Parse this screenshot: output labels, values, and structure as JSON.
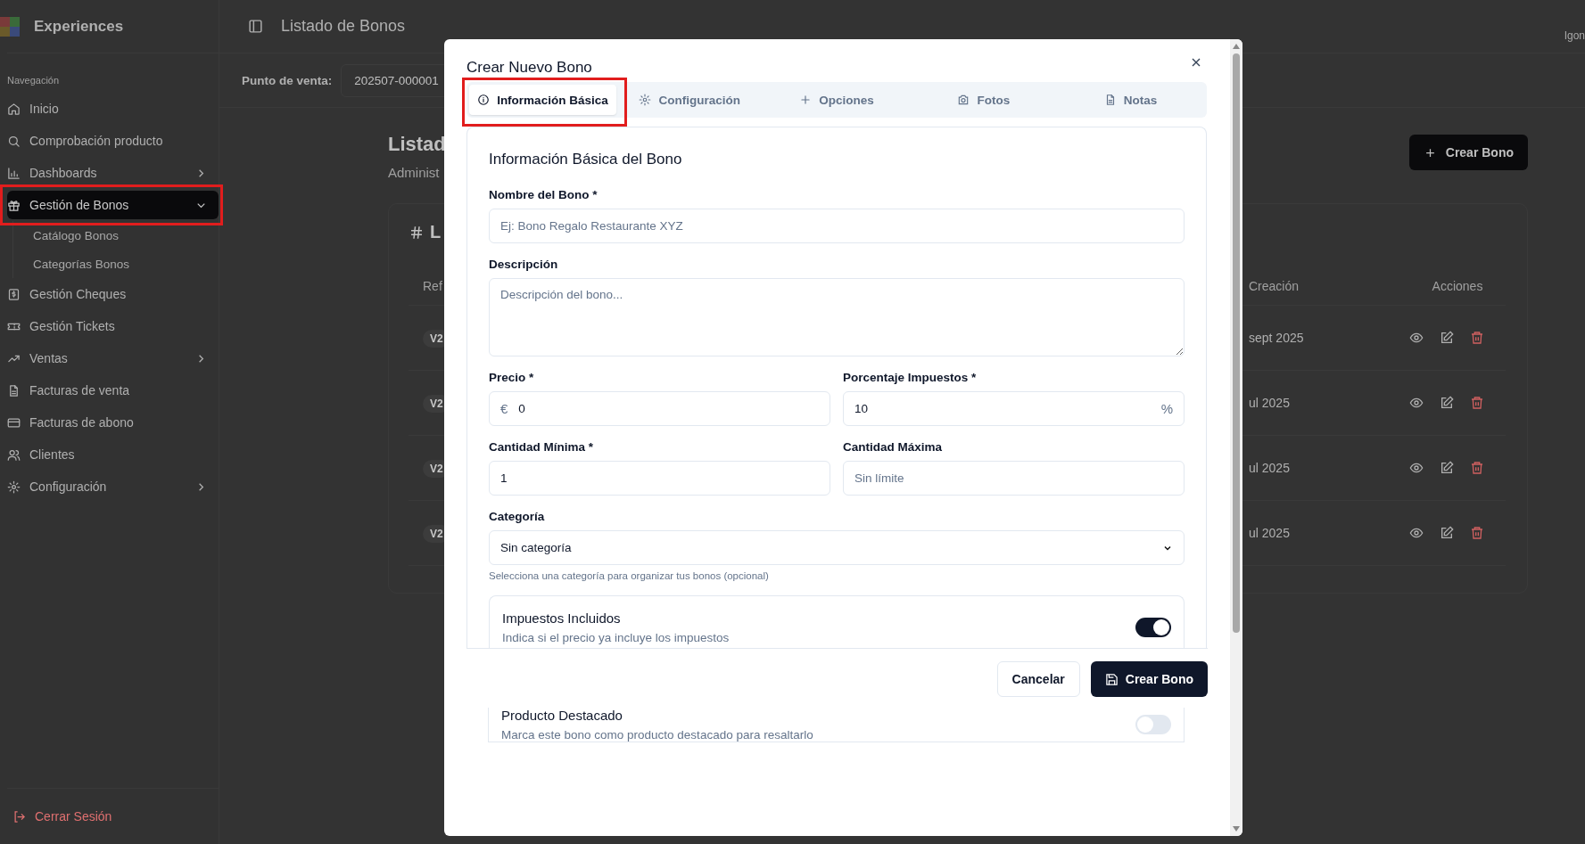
{
  "sidebar": {
    "brand": "Experiences",
    "section_label": "Navegación",
    "items": [
      {
        "label": "Inicio",
        "selected": false,
        "highlighted": false
      },
      {
        "label": "Comprobación producto",
        "selected": false,
        "highlighted": false
      },
      {
        "label": "Dashboards",
        "selected": false,
        "highlighted": false,
        "expanded": false
      },
      {
        "label": "Gestión de Bonos",
        "selected": true,
        "highlighted": true,
        "expanded": true,
        "children": [
          {
            "label": "Catálogo Bonos",
            "selected": false
          },
          {
            "label": "Categorías Bonos",
            "selected": false
          }
        ]
      },
      {
        "label": "Gestión Cheques",
        "selected": false,
        "highlighted": false
      },
      {
        "label": "Gestión Tickets",
        "selected": false,
        "highlighted": false
      },
      {
        "label": "Ventas",
        "selected": false,
        "highlighted": false,
        "expanded": false
      },
      {
        "label": "Facturas de venta",
        "selected": false,
        "highlighted": false
      },
      {
        "label": "Facturas de abono",
        "selected": false,
        "highlighted": false
      },
      {
        "label": "Clientes",
        "selected": false,
        "highlighted": false
      },
      {
        "label": "Configuración",
        "selected": false,
        "highlighted": false,
        "expanded": false
      }
    ],
    "logout": "Cerrar Sesión"
  },
  "header": {
    "title": "Listado de Bonos",
    "user": "Igon"
  },
  "toolbar": {
    "label": "Punto de venta:",
    "value": "202507-000001"
  },
  "page": {
    "title": "Listad",
    "subtitle": "Administ",
    "create_button": "Crear Bono",
    "card_title": "L",
    "table": {
      "columns": [
        "Ref",
        "Creación",
        "Acciones"
      ],
      "rows": [
        {
          "ref": "V2",
          "date": "sept 2025"
        },
        {
          "ref": "V2",
          "date": "ul 2025"
        },
        {
          "ref": "V2",
          "date": "ul 2025"
        },
        {
          "ref": "V2",
          "date": "ul 2025"
        }
      ]
    }
  },
  "modal": {
    "title": "Crear Nuevo Bono",
    "tabs": [
      {
        "label": "Información Básica",
        "selected": true,
        "highlighted": true
      },
      {
        "label": "Configuración",
        "selected": false,
        "highlighted": false
      },
      {
        "label": "Opciones",
        "selected": false,
        "highlighted": false
      },
      {
        "label": "Fotos",
        "selected": false,
        "highlighted": false
      },
      {
        "label": "Notas",
        "selected": false,
        "highlighted": false
      }
    ],
    "section_title": "Información Básica del Bono",
    "name_field": {
      "label": "Nombre del Bono *",
      "placeholder": "Ej: Bono Regalo Restaurante XYZ"
    },
    "description_field": {
      "label": "Descripción",
      "placeholder": "Descripción del bono..."
    },
    "price_field": {
      "label": "Precio *",
      "prefix": "€",
      "value": "0"
    },
    "tax_field": {
      "label": "Porcentaje Impuestos *",
      "value": "10",
      "suffix": "%"
    },
    "min_field": {
      "label": "Cantidad Mínima *",
      "value": "1"
    },
    "max_field": {
      "label": "Cantidad Máxima",
      "placeholder": "Sin límite"
    },
    "category_field": {
      "label": "Categoría",
      "value": "Sin categoría",
      "hint": "Selecciona una categoría para organizar tus bonos (opcional)"
    },
    "toggles": [
      {
        "title": "Impuestos Incluidos",
        "description": "Indica si el precio ya incluye los impuestos",
        "on": true
      },
      {
        "title": "Producto Destacado",
        "description": "Marca este bono como producto destacado para resaltarlo",
        "on": false
      }
    ],
    "buttons": {
      "cancel": "Cancelar",
      "submit": "Crear Bono"
    }
  }
}
